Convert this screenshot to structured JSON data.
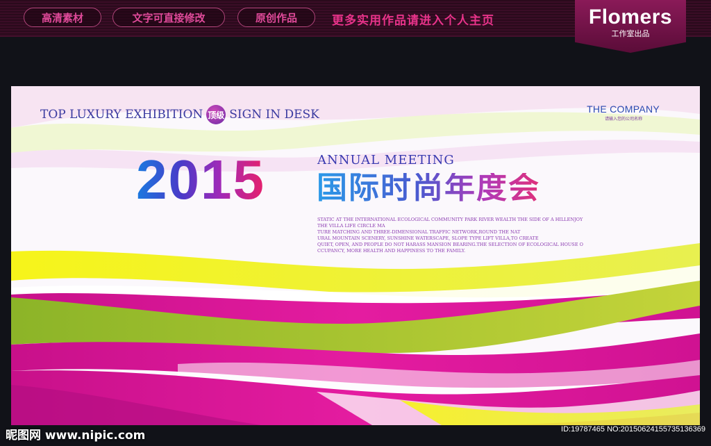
{
  "top_bar": {
    "pills": [
      "高清素材",
      "文字可直接修改",
      "原创作品"
    ],
    "promo": "更多实用作品请进入个人主页",
    "brand_name": "Flomers",
    "brand_sub": "工作室出品"
  },
  "banner": {
    "tagline": {
      "top": "TOP LUXURY EXHIBITION",
      "badge": "顶级",
      "sign": "SIGN IN DESK"
    },
    "company": {
      "name": "THE COMPANY",
      "sub": "请输入您的公司名称"
    },
    "year": "2015",
    "annual": "ANNUAL MEETING",
    "title_cn": "国际时尚年度会",
    "description": [
      "STATIC AT THE INTERNATIONAL ECOLOGICAL COMMUNITY PARK RIVER WEALTH THE SIDE OF A HILLENJOY",
      "THE VILLA LIFE CIRCLE MA",
      "TURE MATCHING AND THREE-DIMENSIONAL TRAFFIC NETWORK,ROUND THE NAT",
      "URAL MOUNTAIN SCENERY, SUNSHINE WATERSCAPE, SLOPE TYPE LIFT VILLA,TO CREATE",
      "QUIET, OPEN, AND PEOPLE DO NOT HARASS MANSION BEARING.THE SELECTION OF ECOLOGICAL HOUSE O",
      "CCUPANCY, MORE HEALTH AND HAPPINESS TO THE FAMILY."
    ]
  },
  "footer": {
    "watermark": "昵图网 www.nipic.com",
    "id": "ID:19787465 NO:20150624155735136369"
  },
  "colors": {
    "magenta": "#e0189a",
    "lime": "#a8c82a",
    "yellow": "#f0f020",
    "blue": "#2a4ab0"
  }
}
